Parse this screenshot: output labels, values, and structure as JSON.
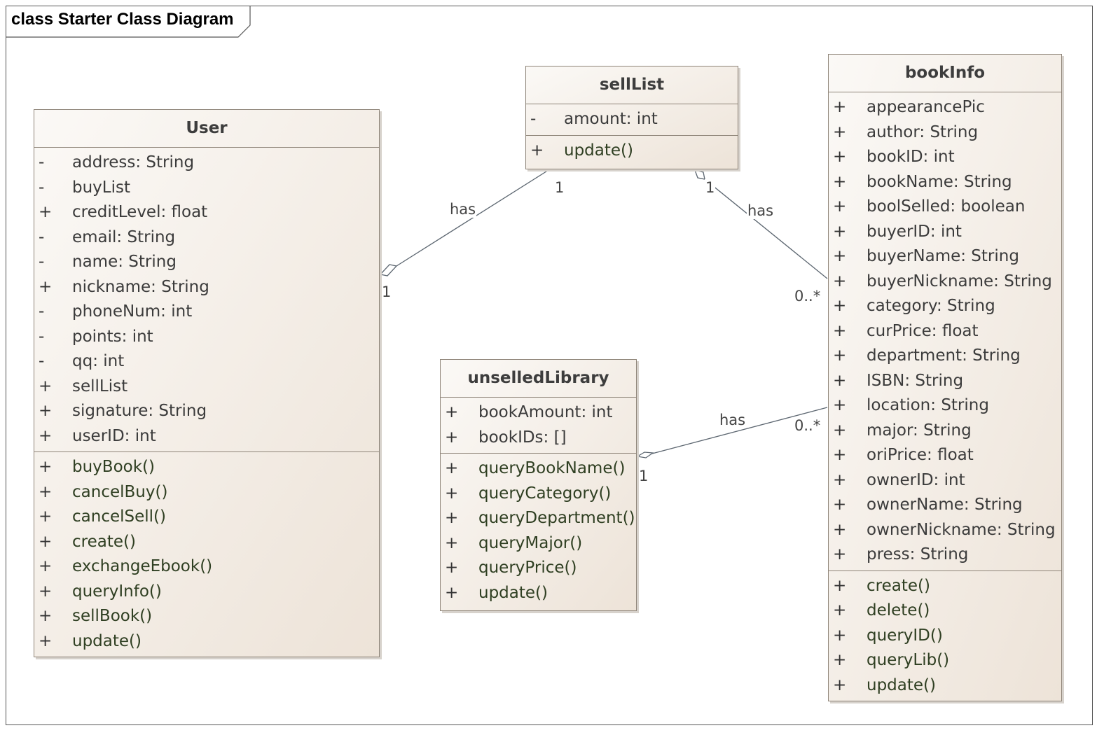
{
  "frame": {
    "title": "class Starter Class Diagram"
  },
  "classes": {
    "user": {
      "name": "User",
      "attributes": [
        {
          "vis": "-",
          "text": "address: String"
        },
        {
          "vis": "-",
          "text": "buyList"
        },
        {
          "vis": "+",
          "text": "creditLevel: float"
        },
        {
          "vis": "-",
          "text": "email: String"
        },
        {
          "vis": "-",
          "text": "name: String"
        },
        {
          "vis": "+",
          "text": "nickname: String"
        },
        {
          "vis": "-",
          "text": "phoneNum: int"
        },
        {
          "vis": "-",
          "text": "points: int"
        },
        {
          "vis": "-",
          "text": "qq: int"
        },
        {
          "vis": "+",
          "text": "sellList"
        },
        {
          "vis": "+",
          "text": "signature: String"
        },
        {
          "vis": "+",
          "text": "userID: int"
        }
      ],
      "operations": [
        {
          "vis": "+",
          "text": "buyBook()"
        },
        {
          "vis": "+",
          "text": "cancelBuy()"
        },
        {
          "vis": "+",
          "text": "cancelSell()"
        },
        {
          "vis": "+",
          "text": "create()"
        },
        {
          "vis": "+",
          "text": "exchangeEbook()"
        },
        {
          "vis": "+",
          "text": "queryInfo()"
        },
        {
          "vis": "+",
          "text": "sellBook()"
        },
        {
          "vis": "+",
          "text": "update()"
        }
      ]
    },
    "sell_list": {
      "name": "sellList",
      "attributes": [
        {
          "vis": "-",
          "text": "amount: int"
        }
      ],
      "operations": [
        {
          "vis": "+",
          "text": "update()"
        }
      ]
    },
    "unselled_library": {
      "name": "unselledLibrary",
      "attributes": [
        {
          "vis": "+",
          "text": "bookAmount: int"
        },
        {
          "vis": "+",
          "text": "bookIDs: []"
        }
      ],
      "operations": [
        {
          "vis": "+",
          "text": "queryBookName()"
        },
        {
          "vis": "+",
          "text": "queryCategory()"
        },
        {
          "vis": "+",
          "text": "queryDepartment()"
        },
        {
          "vis": "+",
          "text": "queryMajor()"
        },
        {
          "vis": "+",
          "text": "queryPrice()"
        },
        {
          "vis": "+",
          "text": "update()"
        }
      ]
    },
    "book_info": {
      "name": "bookInfo",
      "attributes": [
        {
          "vis": "+",
          "text": "appearancePic"
        },
        {
          "vis": "+",
          "text": "author: String"
        },
        {
          "vis": "+",
          "text": "bookID: int"
        },
        {
          "vis": "+",
          "text": "bookName: String"
        },
        {
          "vis": "+",
          "text": "boolSelled: boolean"
        },
        {
          "vis": "+",
          "text": "buyerID: int"
        },
        {
          "vis": "+",
          "text": "buyerName: String"
        },
        {
          "vis": "+",
          "text": "buyerNickname: String"
        },
        {
          "vis": "+",
          "text": "category: String"
        },
        {
          "vis": "+",
          "text": "curPrice: float"
        },
        {
          "vis": "+",
          "text": "department: String"
        },
        {
          "vis": "+",
          "text": "ISBN: String"
        },
        {
          "vis": "+",
          "text": "location: String"
        },
        {
          "vis": "+",
          "text": "major: String"
        },
        {
          "vis": "+",
          "text": "oriPrice: float"
        },
        {
          "vis": "+",
          "text": "ownerID: int"
        },
        {
          "vis": "+",
          "text": "ownerName: String"
        },
        {
          "vis": "+",
          "text": "ownerNickname: String"
        },
        {
          "vis": "+",
          "text": "press: String"
        }
      ],
      "operations": [
        {
          "vis": "+",
          "text": "create()"
        },
        {
          "vis": "+",
          "text": "delete()"
        },
        {
          "vis": "+",
          "text": "queryID()"
        },
        {
          "vis": "+",
          "text": "queryLib()"
        },
        {
          "vis": "+",
          "text": "update()"
        }
      ]
    }
  },
  "associations": [
    {
      "label": "has",
      "source_mult": "1",
      "target_mult": "1"
    },
    {
      "label": "has",
      "source_mult": "1",
      "target_mult": "0..*"
    },
    {
      "label": "has",
      "source_mult": "1",
      "target_mult": "0..*"
    }
  ]
}
